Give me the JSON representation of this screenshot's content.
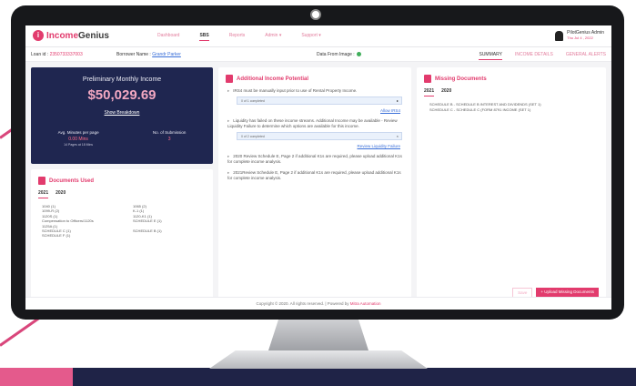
{
  "app": {
    "logo_prefix": "Income",
    "logo_suffix": "Genius",
    "nav": [
      "Dashboard",
      "SBS",
      "Reports",
      "Admin ▾",
      "Support ▾"
    ],
    "user_name": "PilotGenius Admin",
    "user_date": "Thu Jul 4 , 2022"
  },
  "subnav": {
    "loan_label": "Loan id :",
    "loan_value": "2350733337003",
    "borrower_label": "Borrower Name :",
    "borrower_value": "Grandr Parker",
    "date_label": "Data From Image :",
    "tabs": [
      "SUMMARY",
      "INCOME DETAILS",
      "GENERAL ALERTS"
    ]
  },
  "income": {
    "title": "Preliminary Monthly Income",
    "amount": "$50,029.69",
    "link": "Show Breakdown",
    "stat1_label": "Avg. Minutes per page",
    "stat1_value": "0.00 Mins",
    "stat1_sub": "14 Pages at 18 Mins",
    "stat2_label": "No. of Submission",
    "stat2_value": "3"
  },
  "docs": {
    "title": "Documents Used",
    "years": [
      "2021",
      "2020"
    ],
    "col1": [
      "1040 (1)",
      "1099-R (2)",
      "1120S (1)",
      "Compensation to Officers/1120s",
      "1125A (1)",
      "SCHEDULE C (1)",
      "SCHEDULE F (1)"
    ],
    "col2": [
      "1065 (2)",
      "K-1 (1)",
      "1120-K1 (1)",
      "SCHEDULE E (1)",
      "",
      "SCHEDULE B (1)",
      ""
    ]
  },
  "potential": {
    "title": "Additional Income Potential",
    "item1": "IRS4 must be manually input prior to use of Rental Property Income.",
    "box1": "0 of 1 completed",
    "link1": "Allow IRS4",
    "item2": "Liquidity has failed on these income streams. Additional Income may be available - Review Liquidity Failure to determine which options are available for this income.",
    "box2": "0 of 2 completed",
    "link2": "Review Liquidity Failure",
    "item3": "2020 Review Schedule E, Page 2 if additional K1s are required, please upload additional K1s for complete income analysis.",
    "item4": "2021Review Schedule E, Page 2 if additional K1s are required, please upload additional K1s for complete income analysis."
  },
  "missing": {
    "title": "Missing Documents",
    "years": [
      "2021",
      "2020"
    ],
    "line1": "SCHEDULE B - SCHEDULE B INTEREST AND DIVIDENDS (SET 1)",
    "line2": "SCHEDULE C - SCHEDULE C (FORM 8791 INCOME (SET 1)",
    "save": "Save",
    "upload": "+ Upload Missing Documents"
  },
  "footer": {
    "text": "Copyright © 2020. All rights reserved. | Powered by ",
    "brand": "Mitra Automation"
  }
}
